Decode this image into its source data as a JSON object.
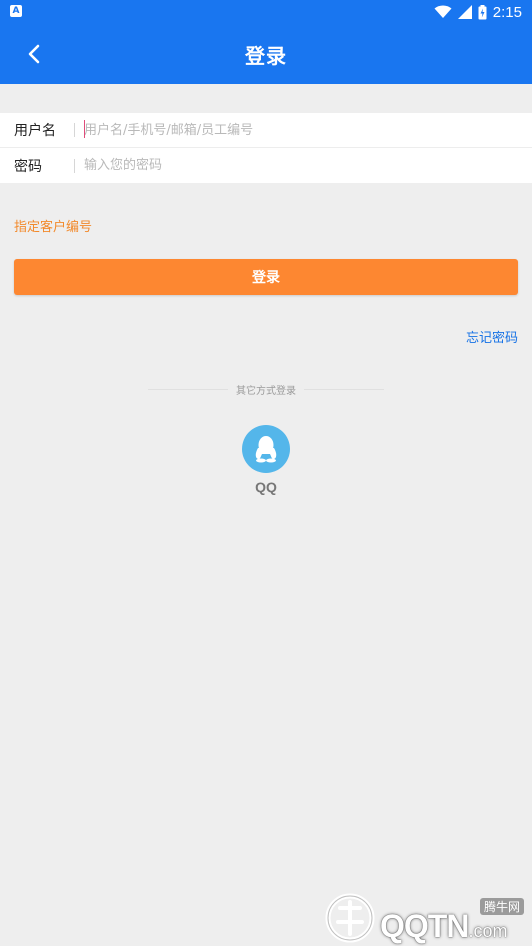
{
  "status_bar": {
    "app_icon": "A",
    "icons": [
      "wifi-icon",
      "signal-icon",
      "battery-icon"
    ],
    "time": "2:15"
  },
  "app_bar": {
    "title": "登录",
    "back_icon": "chevron-left-icon"
  },
  "form": {
    "username": {
      "label": "用户名",
      "placeholder": "用户名/手机号/邮箱/员工编号",
      "value": ""
    },
    "password": {
      "label": "密码",
      "placeholder": "输入您的密码",
      "value": ""
    }
  },
  "customer_link": "指定客户编号",
  "login_button": "登录",
  "forgot_link": "忘记密码",
  "other_login": {
    "divider_text": "其它方式登录",
    "providers": [
      {
        "label": "QQ",
        "icon": "qq-penguin-icon"
      }
    ]
  },
  "colors": {
    "primary": "#1976f0",
    "accent": "#fd8731",
    "link": "#1672e6",
    "qq": "#54b6ea",
    "background": "#eeeeee"
  },
  "watermark": {
    "text": "QQTN",
    "suffix": ".com",
    "badge": "腾牛网"
  }
}
